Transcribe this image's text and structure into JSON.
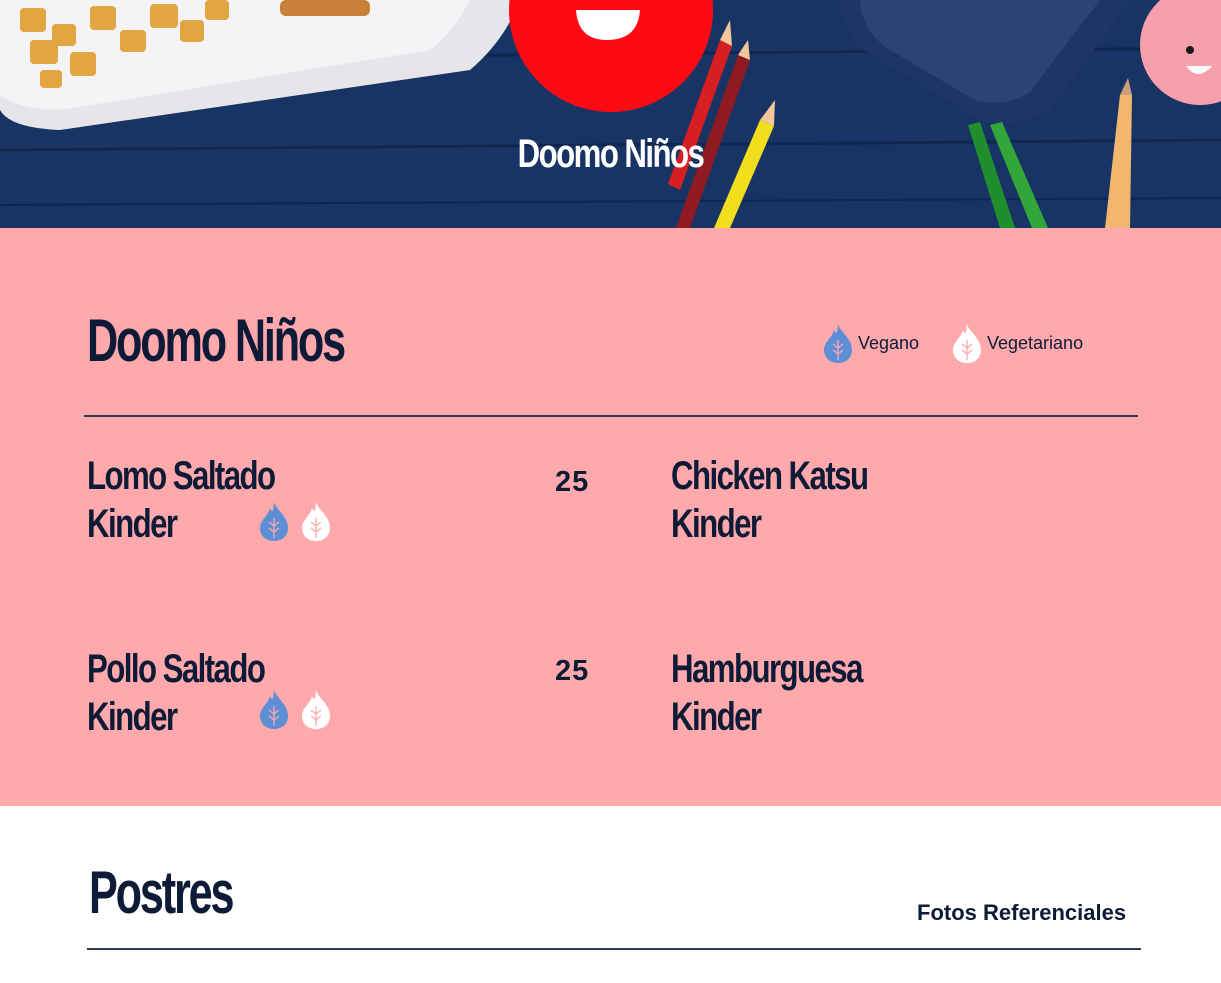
{
  "hero": {
    "title": "Doomo Niños"
  },
  "section": {
    "title": "Doomo Niños",
    "legend": [
      {
        "label": "Vegano",
        "icon": "vegan-flame-icon",
        "color": "#5e8fd6"
      },
      {
        "label": "Vegetariano",
        "icon": "vegetarian-flame-icon",
        "color": "#ffffff"
      }
    ],
    "items": [
      {
        "name_line1": "Lomo Saltado",
        "name_line2": "Kinder",
        "price": "25",
        "vegan": true,
        "vegetarian": true
      },
      {
        "name_line1": "Chicken Katsu",
        "name_line2": "Kinder",
        "price": "",
        "vegan": false,
        "vegetarian": false
      },
      {
        "name_line1": "Pollo Saltado",
        "name_line2": "Kinder",
        "price": "25",
        "vegan": true,
        "vegetarian": true
      },
      {
        "name_line1": "Hamburguesa",
        "name_line2": "Kinder",
        "price": "",
        "vegan": false,
        "vegetarian": false
      }
    ]
  },
  "postres": {
    "title": "Postres",
    "note": "Fotos Referenciales"
  },
  "colors": {
    "pink": "#ffa9ad",
    "navy": "#0e1b36",
    "brand_red": "#ff0a14",
    "vegan_blue": "#5e8fd6"
  }
}
